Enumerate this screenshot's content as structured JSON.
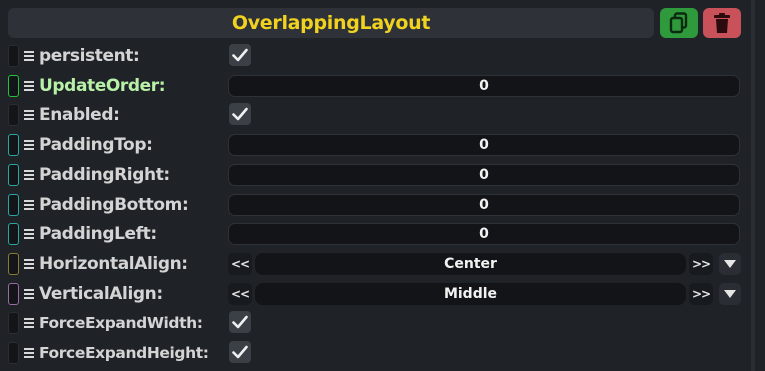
{
  "header": {
    "title": "OverlappingLayout",
    "copy_icon": "copy-icon",
    "delete_icon": "trash-icon"
  },
  "colors": {
    "title": "#f0d21f",
    "copy": "#2f9a3c",
    "delete": "#c9525a",
    "active_label": "#b8f0a8"
  },
  "properties": [
    {
      "label": "persistent:",
      "type": "bool",
      "checked": true,
      "grip": "#2a2d31"
    },
    {
      "label": "UpdateOrder:",
      "type": "number",
      "value": "0",
      "grip": "#1fc43a",
      "active": true
    },
    {
      "label": "Enabled:",
      "type": "bool",
      "checked": true,
      "grip": "#2a2d31"
    },
    {
      "label": "PaddingTop:",
      "type": "number",
      "value": "0",
      "grip": "#2aa7a3"
    },
    {
      "label": "PaddingRight:",
      "type": "number",
      "value": "0",
      "grip": "#2aa7a3"
    },
    {
      "label": "PaddingBottom:",
      "type": "number",
      "value": "0",
      "grip": "#2aa7a3"
    },
    {
      "label": "PaddingLeft:",
      "type": "number",
      "value": "0",
      "grip": "#2aa7a3"
    },
    {
      "label": "HorizontalAlign:",
      "type": "enum",
      "value": "Center",
      "prev": "<<",
      "next": ">>",
      "grip": "#8a7a3a"
    },
    {
      "label": "VerticalAlign:",
      "type": "enum",
      "value": "Middle",
      "prev": "<<",
      "next": ">>",
      "grip": "#9a6aa8"
    },
    {
      "label": "ForceExpandWidth:",
      "type": "bool",
      "checked": true,
      "grip": "#2a2d31",
      "small": true
    },
    {
      "label": "ForceExpandHeight:",
      "type": "bool",
      "checked": true,
      "grip": "#2a2d31",
      "small": true
    }
  ]
}
